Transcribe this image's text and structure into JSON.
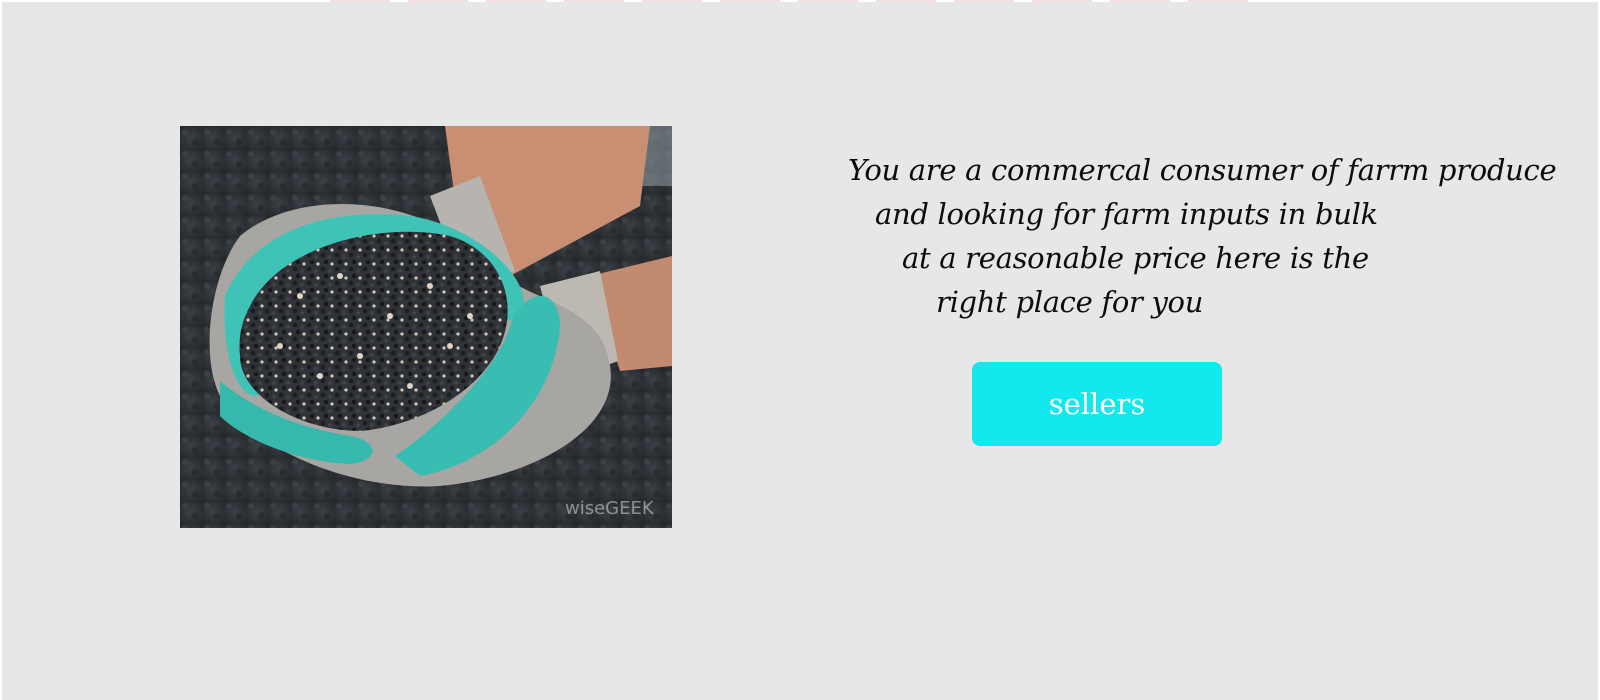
{
  "intro": {
    "lines": [
      "You are a commercal consumer of farrm produce",
      "and looking for farm inputs in bulk",
      "at a reasonable price here is the",
      "right place for you"
    ],
    "button_label": "sellers",
    "image_watermark": "wiseGEEK"
  },
  "colors": {
    "background": "#e7e7e7",
    "button": "#12e8ee",
    "button_text": "#ffffff",
    "text": "#0c0c0c"
  }
}
